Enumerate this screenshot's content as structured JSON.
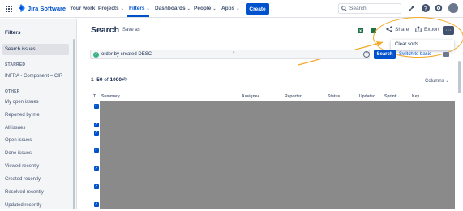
{
  "topnav": {
    "brand": "Jira Software",
    "items": [
      {
        "label": "Your work",
        "chevron": false
      },
      {
        "label": "Projects",
        "chevron": true
      },
      {
        "label": "Filters",
        "chevron": true
      },
      {
        "label": "Dashboards",
        "chevron": true
      },
      {
        "label": "People",
        "chevron": true
      },
      {
        "label": "Apps",
        "chevron": true
      }
    ],
    "create_label": "Create",
    "search_placeholder": "Search",
    "chevron_glyph": "⌄"
  },
  "sidebar": {
    "title": "Filters",
    "search_issues": "Search issues",
    "starred_heading": "STARRED",
    "starred_items": [
      "INFRA - Component = CIR"
    ],
    "other_heading": "OTHER",
    "other_items": [
      "My open issues",
      "Reported by me",
      "All issues",
      "Open issues",
      "Done issues",
      "Viewed recently",
      "Created recently",
      "Resolved recently",
      "Updated recently"
    ]
  },
  "main": {
    "title": "Search",
    "save_as": "Save as",
    "share": "Share",
    "export": "Export",
    "more": "···",
    "dropdown_item": "Clear sorts",
    "jql": "order by created DESC",
    "jql_caret": "^",
    "help": "?",
    "search_button": "Search",
    "switch_basic": "Switch to basic",
    "count_range": "1–50",
    "count_of": " of ",
    "count_total": "1000+",
    "columns": "Columns",
    "columns_chevron": "⌄",
    "headers": [
      "T",
      "Summary",
      "Assignee",
      "Reporter",
      "Status",
      "Updated",
      "Sprint",
      "Key"
    ]
  },
  "colors": {
    "brand": "#0052cc",
    "annotation": "#f5a623",
    "redaction": "#8a8a8a"
  }
}
